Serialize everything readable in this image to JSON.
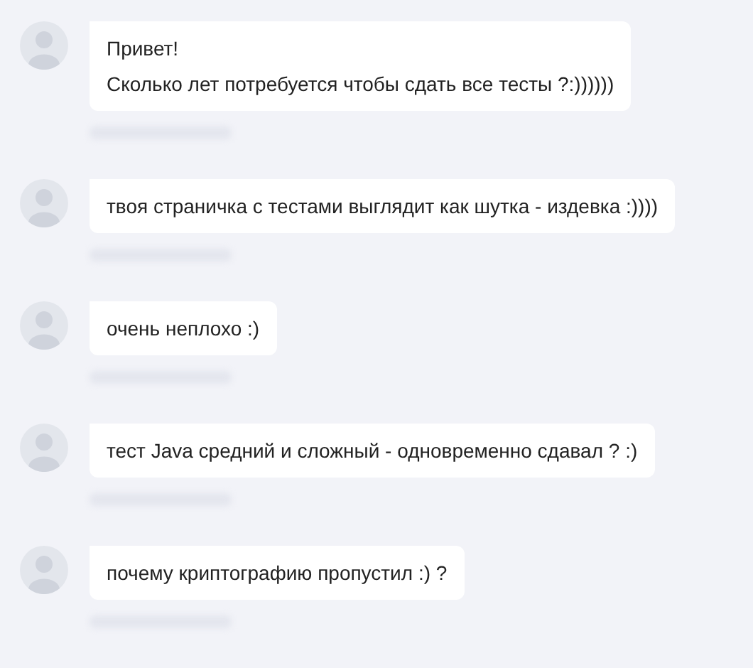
{
  "messages": [
    {
      "lines": [
        "Привет!",
        "Сколько лет потребуется чтобы сдать все тесты ?:))))))"
      ]
    },
    {
      "lines": [
        "твоя страничка с тестами выглядит как шутка - издевка :))))"
      ]
    },
    {
      "lines": [
        "очень неплохо :)"
      ]
    },
    {
      "lines": [
        "тест Java средний и сложный - одновременно сдавал ? :)"
      ]
    },
    {
      "lines": [
        "почему криптографию пропустил :) ?"
      ]
    }
  ]
}
